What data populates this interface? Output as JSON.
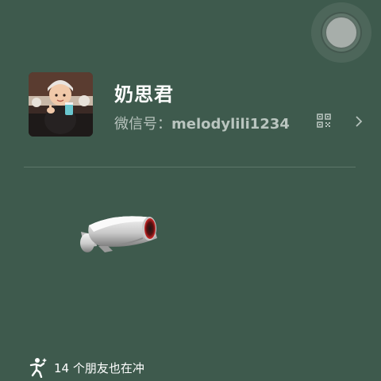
{
  "floating_button": {
    "icon": "floating-circle-icon"
  },
  "profile": {
    "name": "奶思君",
    "wechat_id_label": "微信号：",
    "wechat_id": "melodylili1234",
    "qr_icon": "qr-code-icon",
    "chevron_icon": "chevron-right-icon"
  },
  "sticker": {
    "icon": "security-camera-sticker"
  },
  "footer": {
    "icon": "running-figure-icon",
    "friends_text": "14 个朋友也在冲"
  }
}
